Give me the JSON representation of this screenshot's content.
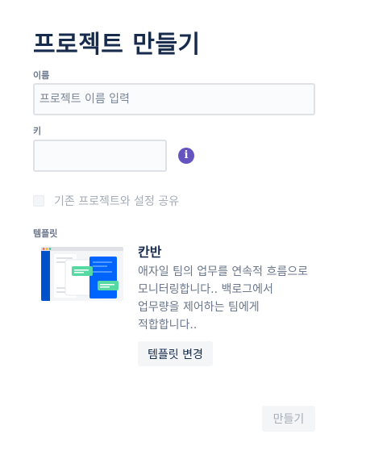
{
  "page": {
    "title": "프로젝트 만들기"
  },
  "form": {
    "name_label": "이름",
    "name_placeholder": "프로젝트 이름 입력",
    "name_value": "",
    "key_label": "키",
    "key_value": "",
    "info_icon": "i",
    "share_checkbox_label": "기존 프로젝트와 설정 공유",
    "share_checked": false
  },
  "template": {
    "section_label": "템플릿",
    "name": "칸반",
    "description": "애자일 팀의 업무를 연속적 흐름으로 모니터링합니다.. 백로그에서 업무량을 제어하는 팀에게 적합합니다..",
    "change_button": "템플릿 변경",
    "thumbnail_icon": "kanban-board-illustration"
  },
  "footer": {
    "create_button": "만들기",
    "create_enabled": false
  },
  "colors": {
    "primary_text": "#172b4d",
    "muted_text": "#6b778c",
    "info_icon": "#6554c0",
    "kanban_blue": "#0065ff",
    "kanban_green": "#57d9a3"
  }
}
